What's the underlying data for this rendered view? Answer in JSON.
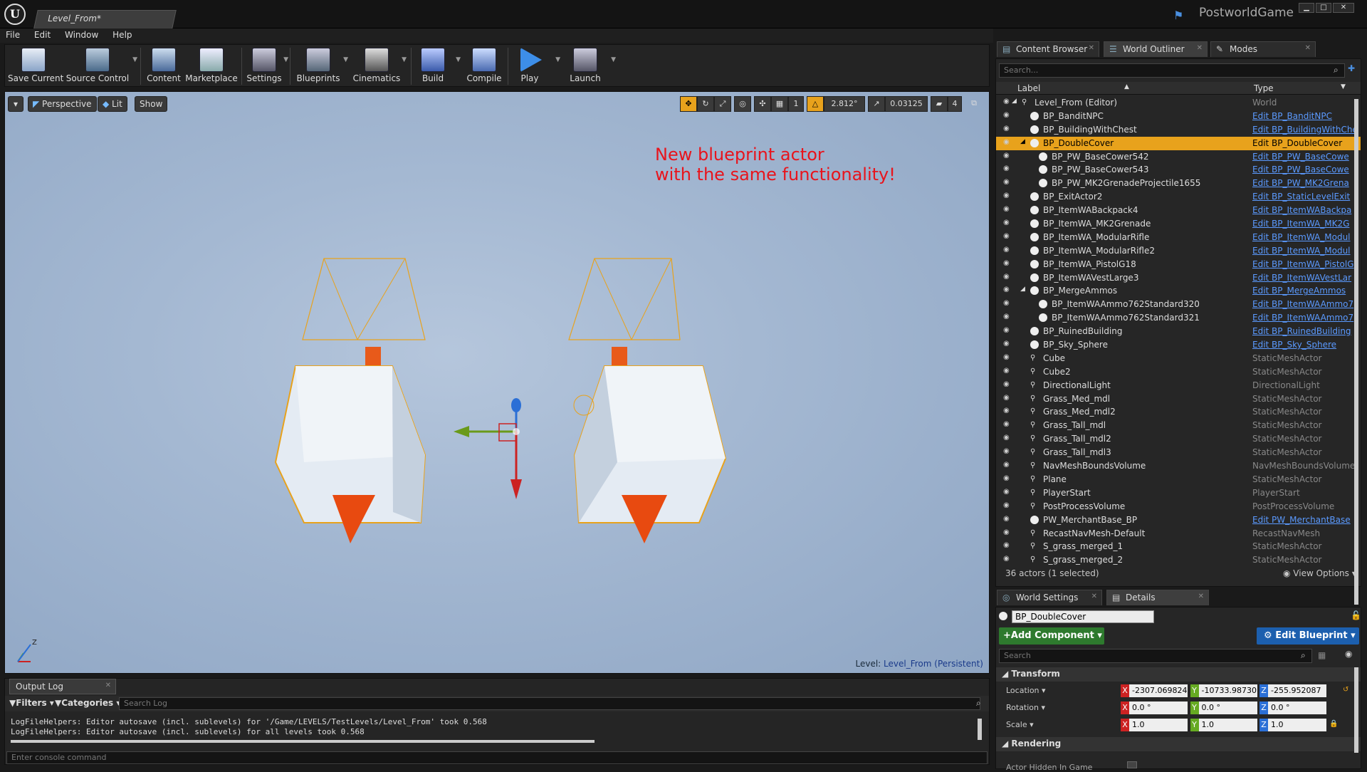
{
  "window": {
    "doc_tab": "Level_From*",
    "project_name": "PostworldGame"
  },
  "menu": [
    "File",
    "Edit",
    "Window",
    "Help"
  ],
  "toolbar": {
    "save_current": "Save Current",
    "source_control": "Source Control",
    "content": "Content",
    "marketplace": "Marketplace",
    "settings": "Settings",
    "blueprints": "Blueprints",
    "cinematics": "Cinematics",
    "build": "Build",
    "compile": "Compile",
    "play": "Play",
    "launch": "Launch"
  },
  "viewport": {
    "perspective": "Perspective",
    "lit": "Lit",
    "show": "Show",
    "rotation_snap": "2.812°",
    "scale_snap": "0.03125",
    "grid_value": "1",
    "camera_speed": "4",
    "annotation_line1": "New blueprint actor",
    "annotation_line2": "with the same functionality!",
    "level_prefix": "Level:",
    "level_name": "Level_From (Persistent)"
  },
  "output_log": {
    "tab": "Output Log",
    "filters": "Filters",
    "categories": "Categories",
    "search_placeholder": "Search Log",
    "lines": [
      "LogFileHelpers: Editor autosave (incl. sublevels) for '/Game/LEVELS/TestLevels/Level_From' took 0.568",
      "LogFileHelpers: Editor autosave (incl. sublevels) for all levels took 0.568"
    ],
    "console_placeholder": "Enter console command"
  },
  "panel_tabs": {
    "content_browser": "Content Browser",
    "world_outliner": "World Outliner",
    "modes": "Modes",
    "world_settings": "World Settings",
    "details": "Details"
  },
  "outliner": {
    "search_placeholder": "Search...",
    "col_label": "Label",
    "col_type": "Type",
    "rows": [
      {
        "label": "Level_From (Editor)",
        "type": "World",
        "link": false,
        "indent": 0
      },
      {
        "label": "BP_BanditNPC",
        "type": "Edit BP_BanditNPC",
        "link": true,
        "indent": 1
      },
      {
        "label": "BP_BuildingWithChest",
        "type": "Edit BP_BuildingWithChe",
        "link": true,
        "indent": 1
      },
      {
        "label": "BP_DoubleCover",
        "type": "Edit BP_DoubleCover",
        "link": true,
        "indent": 1,
        "selected": true
      },
      {
        "label": "BP_PW_BaseCower542",
        "type": "Edit BP_PW_BaseCowe",
        "link": true,
        "indent": 2
      },
      {
        "label": "BP_PW_BaseCower543",
        "type": "Edit BP_PW_BaseCowe",
        "link": true,
        "indent": 2
      },
      {
        "label": "BP_PW_MK2GrenadeProjectile1655",
        "type": "Edit BP_PW_MK2Grena",
        "link": true,
        "indent": 2
      },
      {
        "label": "BP_ExitActor2",
        "type": "Edit BP_StaticLevelExit",
        "link": true,
        "indent": 1
      },
      {
        "label": "BP_ItemWABackpack4",
        "type": "Edit BP_ItemWABackpa",
        "link": true,
        "indent": 1
      },
      {
        "label": "BP_ItemWA_MK2Grenade",
        "type": "Edit BP_ItemWA_MK2G",
        "link": true,
        "indent": 1
      },
      {
        "label": "BP_ItemWA_ModularRifle",
        "type": "Edit BP_ItemWA_Modul",
        "link": true,
        "indent": 1
      },
      {
        "label": "BP_ItemWA_ModularRifle2",
        "type": "Edit BP_ItemWA_Modul",
        "link": true,
        "indent": 1
      },
      {
        "label": "BP_ItemWA_PistolG18",
        "type": "Edit BP_ItemWA_PistolG",
        "link": true,
        "indent": 1
      },
      {
        "label": "BP_ItemWAVestLarge3",
        "type": "Edit BP_ItemWAVestLar",
        "link": true,
        "indent": 1
      },
      {
        "label": "BP_MergeAmmos",
        "type": "Edit BP_MergeAmmos",
        "link": true,
        "indent": 1
      },
      {
        "label": "BP_ItemWAAmmo762Standard320",
        "type": "Edit BP_ItemWAAmmo7",
        "link": true,
        "indent": 2
      },
      {
        "label": "BP_ItemWAAmmo762Standard321",
        "type": "Edit BP_ItemWAAmmo7",
        "link": true,
        "indent": 2
      },
      {
        "label": "BP_RuinedBuilding",
        "type": "Edit BP_RuinedBuilding",
        "link": true,
        "indent": 1
      },
      {
        "label": "BP_Sky_Sphere",
        "type": "Edit BP_Sky_Sphere",
        "link": true,
        "indent": 1
      },
      {
        "label": "Cube",
        "type": "StaticMeshActor",
        "link": false,
        "indent": 1
      },
      {
        "label": "Cube2",
        "type": "StaticMeshActor",
        "link": false,
        "indent": 1
      },
      {
        "label": "DirectionalLight",
        "type": "DirectionalLight",
        "link": false,
        "indent": 1
      },
      {
        "label": "Grass_Med_mdl",
        "type": "StaticMeshActor",
        "link": false,
        "indent": 1
      },
      {
        "label": "Grass_Med_mdl2",
        "type": "StaticMeshActor",
        "link": false,
        "indent": 1
      },
      {
        "label": "Grass_Tall_mdl",
        "type": "StaticMeshActor",
        "link": false,
        "indent": 1
      },
      {
        "label": "Grass_Tall_mdl2",
        "type": "StaticMeshActor",
        "link": false,
        "indent": 1
      },
      {
        "label": "Grass_Tall_mdl3",
        "type": "StaticMeshActor",
        "link": false,
        "indent": 1
      },
      {
        "label": "NavMeshBoundsVolume",
        "type": "NavMeshBoundsVolume",
        "link": false,
        "indent": 1
      },
      {
        "label": "Plane",
        "type": "StaticMeshActor",
        "link": false,
        "indent": 1
      },
      {
        "label": "PlayerStart",
        "type": "PlayerStart",
        "link": false,
        "indent": 1
      },
      {
        "label": "PostProcessVolume",
        "type": "PostProcessVolume",
        "link": false,
        "indent": 1
      },
      {
        "label": "PW_MerchantBase_BP",
        "type": "Edit PW_MerchantBase",
        "link": true,
        "indent": 1
      },
      {
        "label": "RecastNavMesh-Default",
        "type": "RecastNavMesh",
        "link": false,
        "indent": 1
      },
      {
        "label": "S_grass_merged_1",
        "type": "StaticMeshActor",
        "link": false,
        "indent": 1
      },
      {
        "label": "S_grass_merged_2",
        "type": "StaticMeshActor",
        "link": false,
        "indent": 1
      }
    ],
    "actor_count": "36 actors (1 selected)",
    "view_options": "View Options"
  },
  "details": {
    "actor_name": "BP_DoubleCover",
    "add_component": "Add Component",
    "edit_blueprint": "Edit Blueprint",
    "search_placeholder": "Search",
    "transform": "Transform",
    "location_label": "Location",
    "rotation_label": "Rotation",
    "scale_label": "Scale",
    "location": [
      "-2307.069824",
      "-10733.98730",
      "-255.952087"
    ],
    "rotation": [
      "0.0 °",
      "0.0 °",
      "0.0 °"
    ],
    "scale": [
      "1.0",
      "1.0",
      "1.0"
    ],
    "rendering": "Rendering",
    "actor_hidden": "Actor Hidden In Game"
  }
}
